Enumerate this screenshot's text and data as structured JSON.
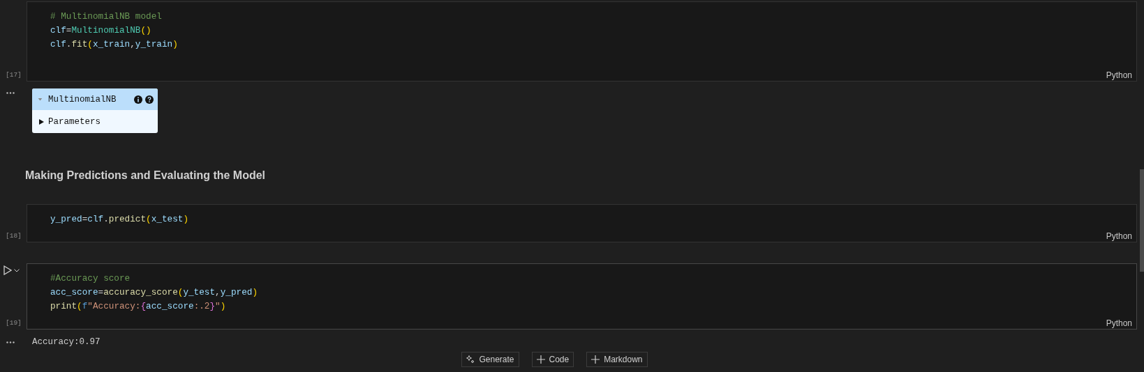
{
  "blocks": [
    {
      "kind": "code",
      "count": "[17]",
      "language": "Python",
      "hovered": false,
      "lines": [
        [
          {
            "kind": "comment",
            "text": "# MultinomialNB model"
          }
        ],
        [
          {
            "kind": "var",
            "text": "clf"
          },
          {
            "kind": "op",
            "text": "="
          },
          {
            "kind": "class",
            "text": "MultinomialNB"
          },
          {
            "kind": "paren",
            "text": "()"
          }
        ],
        [
          {
            "kind": "var",
            "text": "clf"
          },
          {
            "kind": "op",
            "text": "."
          },
          {
            "kind": "func",
            "text": "fit"
          },
          {
            "kind": "paren",
            "text": "("
          },
          {
            "kind": "var",
            "text": "x_train"
          },
          {
            "kind": "op",
            "text": ","
          },
          {
            "kind": "var",
            "text": "y_train"
          },
          {
            "kind": "paren",
            "text": ")"
          }
        ]
      ],
      "output": {
        "kind": "estimator",
        "name": "MultinomialNB",
        "expanded": true,
        "section": {
          "label": "Parameters",
          "expanded": false
        }
      }
    },
    {
      "kind": "markdown",
      "heading": "Making Predictions and Evaluating the Model"
    },
    {
      "kind": "code",
      "count": "[18]",
      "language": "Python",
      "hovered": false,
      "lines": [
        [
          {
            "kind": "var",
            "text": "y_pred"
          },
          {
            "kind": "op",
            "text": "="
          },
          {
            "kind": "var",
            "text": "clf"
          },
          {
            "kind": "op",
            "text": "."
          },
          {
            "kind": "func",
            "text": "predict"
          },
          {
            "kind": "paren",
            "text": "("
          },
          {
            "kind": "var",
            "text": "x_test"
          },
          {
            "kind": "paren",
            "text": ")"
          }
        ]
      ]
    },
    {
      "kind": "code",
      "count": "[19]",
      "language": "Python",
      "hovered": true,
      "lines": [
        [
          {
            "kind": "comment",
            "text": "#Accuracy score"
          }
        ],
        [
          {
            "kind": "var",
            "text": "acc_score"
          },
          {
            "kind": "op",
            "text": "="
          },
          {
            "kind": "func",
            "text": "accuracy_score"
          },
          {
            "kind": "paren",
            "text": "("
          },
          {
            "kind": "var",
            "text": "y_test"
          },
          {
            "kind": "op",
            "text": ","
          },
          {
            "kind": "var",
            "text": "y_pred"
          },
          {
            "kind": "paren",
            "text": ")"
          }
        ],
        [
          {
            "kind": "func",
            "text": "print"
          },
          {
            "kind": "paren",
            "text": "("
          },
          {
            "kind": "keyword",
            "text": "f"
          },
          {
            "kind": "string",
            "text": "\"Accuracy:"
          },
          {
            "kind": "brace",
            "text": "{"
          },
          {
            "kind": "var",
            "text": "acc_score"
          },
          {
            "kind": "string",
            "text": ":.2"
          },
          {
            "kind": "brace",
            "text": "}"
          },
          {
            "kind": "string",
            "text": "\""
          },
          {
            "kind": "paren",
            "text": ")"
          }
        ]
      ],
      "output": {
        "kind": "text",
        "text": "Accuracy:0.97"
      }
    }
  ],
  "toolbar": [
    {
      "kind": "generate",
      "label": "Generate"
    },
    {
      "kind": "add",
      "label": "Code"
    },
    {
      "kind": "add",
      "label": "Markdown"
    }
  ]
}
